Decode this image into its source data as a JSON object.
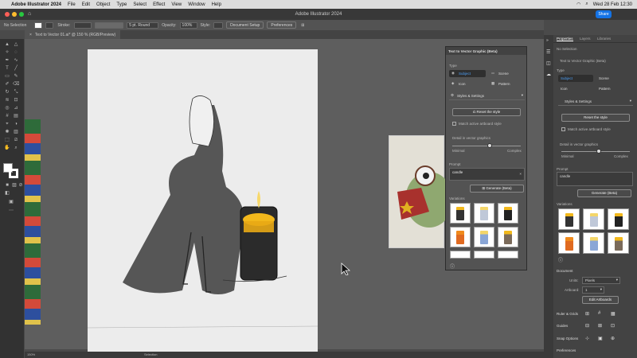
{
  "menubar": {
    "app": "Adobe Illustrator 2024",
    "items": [
      "File",
      "Edit",
      "Object",
      "Type",
      "Select",
      "Effect",
      "View",
      "Window",
      "Help"
    ],
    "datetime": "Wed 28 Feb 12:30"
  },
  "titlebar": {
    "title": "Adobe Illustrator 2024",
    "share": "Share"
  },
  "control": {
    "selection": "No Selection",
    "stroke_label": "Stroke:",
    "brush": "5 pt. Round",
    "opacity_label": "Opacity:",
    "opacity_value": "100%",
    "style_label": "Style:",
    "doc_setup": "Document Setup",
    "preferences": "Preferences"
  },
  "tab": {
    "label": "Text to Vector 01.ai* @ 150 % (RGB/Preview)"
  },
  "status": {
    "zoom": "150%",
    "mode": "Selection"
  },
  "t2v": {
    "title": "Text to Vector Graphic (Beta)",
    "type_label": "Type",
    "types": [
      "Subject",
      "Scene",
      "Icon",
      "Pattern"
    ],
    "styles_label": "Styles & Settings",
    "reset": "Reset the style",
    "match": "Match active artboard style",
    "detail_label": "Detail in vector graphics",
    "detail_value": 0.55,
    "minimal": "Minimal",
    "complex": "Complex",
    "prompt_label": "Prompt",
    "prompt_value": "candle",
    "generate": "Generate (Beta)",
    "variations_label": "Variations"
  },
  "rpanel": {
    "tabs": [
      "Properties",
      "Layers",
      "Libraries"
    ],
    "no_selection": "No Selection",
    "section_title": "Text to Vector Graphic (Beta)",
    "type_label": "Type",
    "types": [
      "Subject",
      "Scene",
      "Icon",
      "Pattern"
    ],
    "styles_label": "Styles & Settings",
    "reset": "Reset the style",
    "match": "Match active artboard style",
    "detail_label": "Detail in vector graphics",
    "minimal": "Minimal",
    "complex": "Complex",
    "prompt_label": "Prompt",
    "prompt_value": "candle",
    "generate": "Generate (Beta)",
    "variations_label": "Variations",
    "document_label": "Document",
    "units_label": "Units:",
    "units_value": "Pixels",
    "artboard_label": "Artboard:",
    "artboard_value": "1",
    "edit_artboards": "Edit Artboards",
    "ruler_label": "Ruler & Grids",
    "guides_label": "Guides",
    "snap_label": "Snap Options",
    "preferences_label": "Preferences"
  },
  "colors": {
    "accent": "#1473e6",
    "candle_glow": "#f2b81c"
  }
}
